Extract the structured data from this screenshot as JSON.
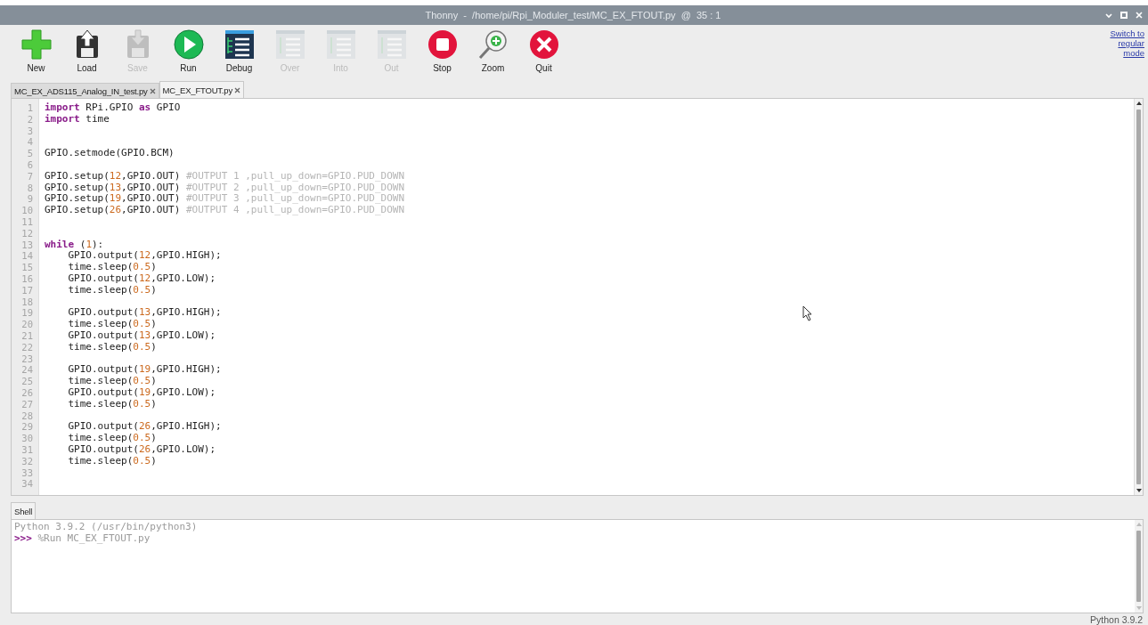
{
  "window": {
    "title": "Thonny  -  /home/pi/Rpi_Moduler_test/MC_EX_FTOUT.py  @  35 : 1"
  },
  "toolbar": {
    "buttons": [
      {
        "kind": "new",
        "label": "New",
        "disabled": false
      },
      {
        "kind": "load",
        "label": "Load",
        "disabled": false
      },
      {
        "kind": "save",
        "label": "Save",
        "disabled": true
      },
      {
        "kind": "run",
        "label": "Run",
        "disabled": false
      },
      {
        "kind": "debug",
        "label": "Debug",
        "disabled": false
      },
      {
        "kind": "over",
        "label": "Over",
        "disabled": true
      },
      {
        "kind": "into",
        "label": "Into",
        "disabled": true
      },
      {
        "kind": "out",
        "label": "Out",
        "disabled": true
      },
      {
        "kind": "stop",
        "label": "Stop",
        "disabled": false
      },
      {
        "kind": "zoom",
        "label": "Zoom",
        "disabled": false
      },
      {
        "kind": "quit",
        "label": "Quit",
        "disabled": false
      }
    ],
    "mode_link": "Switch to regular mode"
  },
  "editor_tabs": [
    {
      "label": "MC_EX_ADS115_Analog_IN_test.py",
      "selected": false
    },
    {
      "label": "MC_EX_FTOUT.py",
      "selected": true
    }
  ],
  "editor": {
    "lines": [
      {
        "number": "1",
        "tokens": [
          {
            "kind": "kw",
            "text": "import"
          },
          {
            "kind": "plain",
            "text": " RPi.GPIO "
          },
          {
            "kind": "kw",
            "text": "as"
          },
          {
            "kind": "plain",
            "text": " GPIO"
          }
        ]
      },
      {
        "number": "2",
        "tokens": [
          {
            "kind": "kw",
            "text": "import"
          },
          {
            "kind": "plain",
            "text": " time"
          }
        ]
      },
      {
        "number": "3"
      },
      {
        "number": "4"
      },
      {
        "number": "5",
        "tokens": [
          {
            "kind": "plain",
            "text": "GPIO.setmode(GPIO.BCM)"
          }
        ]
      },
      {
        "number": "6"
      },
      {
        "number": "7",
        "tokens": [
          {
            "kind": "plain",
            "text": "GPIO.setup("
          },
          {
            "kind": "num",
            "text": "12"
          },
          {
            "kind": "plain",
            "text": ",GPIO.OUT) "
          },
          {
            "kind": "comment",
            "text": "#OUTPUT 1 ,pull_up_down=GPIO.PUD_DOWN"
          }
        ]
      },
      {
        "number": "8",
        "tokens": [
          {
            "kind": "plain",
            "text": "GPIO.setup("
          },
          {
            "kind": "num",
            "text": "13"
          },
          {
            "kind": "plain",
            "text": ",GPIO.OUT) "
          },
          {
            "kind": "comment",
            "text": "#OUTPUT 2 ,pull_up_down=GPIO.PUD_DOWN"
          }
        ]
      },
      {
        "number": "9",
        "tokens": [
          {
            "kind": "plain",
            "text": "GPIO.setup("
          },
          {
            "kind": "num",
            "text": "19"
          },
          {
            "kind": "plain",
            "text": ",GPIO.OUT) "
          },
          {
            "kind": "comment",
            "text": "#OUTPUT 3 ,pull_up_down=GPIO.PUD_DOWN"
          }
        ]
      },
      {
        "number": "10",
        "tokens": [
          {
            "kind": "plain",
            "text": "GPIO.setup("
          },
          {
            "kind": "num",
            "text": "26"
          },
          {
            "kind": "plain",
            "text": ",GPIO.OUT) "
          },
          {
            "kind": "comment",
            "text": "#OUTPUT 4 ,pull_up_down=GPIO.PUD_DOWN"
          }
        ]
      },
      {
        "number": "11"
      },
      {
        "number": "12"
      },
      {
        "number": "13",
        "tokens": [
          {
            "kind": "kw",
            "text": "while"
          },
          {
            "kind": "plain",
            "text": " ("
          },
          {
            "kind": "num",
            "text": "1"
          },
          {
            "kind": "plain",
            "text": "):"
          }
        ]
      },
      {
        "number": "14",
        "tokens": [
          {
            "kind": "plain",
            "text": "    GPIO.output("
          },
          {
            "kind": "num",
            "text": "12"
          },
          {
            "kind": "plain",
            "text": ",GPIO.HIGH);"
          }
        ]
      },
      {
        "number": "15",
        "tokens": [
          {
            "kind": "plain",
            "text": "    time.sleep("
          },
          {
            "kind": "num",
            "text": "0.5"
          },
          {
            "kind": "plain",
            "text": ")"
          }
        ]
      },
      {
        "number": "16",
        "tokens": [
          {
            "kind": "plain",
            "text": "    GPIO.output("
          },
          {
            "kind": "num",
            "text": "12"
          },
          {
            "kind": "plain",
            "text": ",GPIO.LOW);"
          }
        ]
      },
      {
        "number": "17",
        "tokens": [
          {
            "kind": "plain",
            "text": "    time.sleep("
          },
          {
            "kind": "num",
            "text": "0.5"
          },
          {
            "kind": "plain",
            "text": ")"
          }
        ]
      },
      {
        "number": "18"
      },
      {
        "number": "19",
        "tokens": [
          {
            "kind": "plain",
            "text": "    GPIO.output("
          },
          {
            "kind": "num",
            "text": "13"
          },
          {
            "kind": "plain",
            "text": ",GPIO.HIGH);"
          }
        ]
      },
      {
        "number": "20",
        "tokens": [
          {
            "kind": "plain",
            "text": "    time.sleep("
          },
          {
            "kind": "num",
            "text": "0.5"
          },
          {
            "kind": "plain",
            "text": ")"
          }
        ]
      },
      {
        "number": "21",
        "tokens": [
          {
            "kind": "plain",
            "text": "    GPIO.output("
          },
          {
            "kind": "num",
            "text": "13"
          },
          {
            "kind": "plain",
            "text": ",GPIO.LOW);"
          }
        ]
      },
      {
        "number": "22",
        "tokens": [
          {
            "kind": "plain",
            "text": "    time.sleep("
          },
          {
            "kind": "num",
            "text": "0.5"
          },
          {
            "kind": "plain",
            "text": ")"
          }
        ]
      },
      {
        "number": "23"
      },
      {
        "number": "24",
        "tokens": [
          {
            "kind": "plain",
            "text": "    GPIO.output("
          },
          {
            "kind": "num",
            "text": "19"
          },
          {
            "kind": "plain",
            "text": ",GPIO.HIGH);"
          }
        ]
      },
      {
        "number": "25",
        "tokens": [
          {
            "kind": "plain",
            "text": "    time.sleep("
          },
          {
            "kind": "num",
            "text": "0.5"
          },
          {
            "kind": "plain",
            "text": ")"
          }
        ]
      },
      {
        "number": "26",
        "tokens": [
          {
            "kind": "plain",
            "text": "    GPIO.output("
          },
          {
            "kind": "num",
            "text": "19"
          },
          {
            "kind": "plain",
            "text": ",GPIO.LOW);"
          }
        ]
      },
      {
        "number": "27",
        "tokens": [
          {
            "kind": "plain",
            "text": "    time.sleep("
          },
          {
            "kind": "num",
            "text": "0.5"
          },
          {
            "kind": "plain",
            "text": ")"
          }
        ]
      },
      {
        "number": "28"
      },
      {
        "number": "29",
        "tokens": [
          {
            "kind": "plain",
            "text": "    GPIO.output("
          },
          {
            "kind": "num",
            "text": "26"
          },
          {
            "kind": "plain",
            "text": ",GPIO.HIGH);"
          }
        ]
      },
      {
        "number": "30",
        "tokens": [
          {
            "kind": "plain",
            "text": "    time.sleep("
          },
          {
            "kind": "num",
            "text": "0.5"
          },
          {
            "kind": "plain",
            "text": ")"
          }
        ]
      },
      {
        "number": "31",
        "tokens": [
          {
            "kind": "plain",
            "text": "    GPIO.output("
          },
          {
            "kind": "num",
            "text": "26"
          },
          {
            "kind": "plain",
            "text": ",GPIO.LOW);"
          }
        ]
      },
      {
        "number": "32",
        "tokens": [
          {
            "kind": "plain",
            "text": "    time.sleep("
          },
          {
            "kind": "num",
            "text": "0.5"
          },
          {
            "kind": "plain",
            "text": ")"
          }
        ]
      },
      {
        "number": "33"
      },
      {
        "number": "34"
      }
    ]
  },
  "shell_tabs": [
    {
      "label": "Shell",
      "selected": true
    }
  ],
  "shell": {
    "lines": [
      {
        "tokens": [
          {
            "kind": "output",
            "text": "Python 3.9.2 (/usr/bin/python3)"
          }
        ]
      },
      {
        "tokens": [
          {
            "kind": "prompt",
            "text": ">>>"
          },
          {
            "kind": "output",
            "text": " %Run MC_EX_FTOUT.py"
          }
        ]
      }
    ]
  },
  "status_bar": {
    "interpreter": "Python 3.9.2"
  }
}
